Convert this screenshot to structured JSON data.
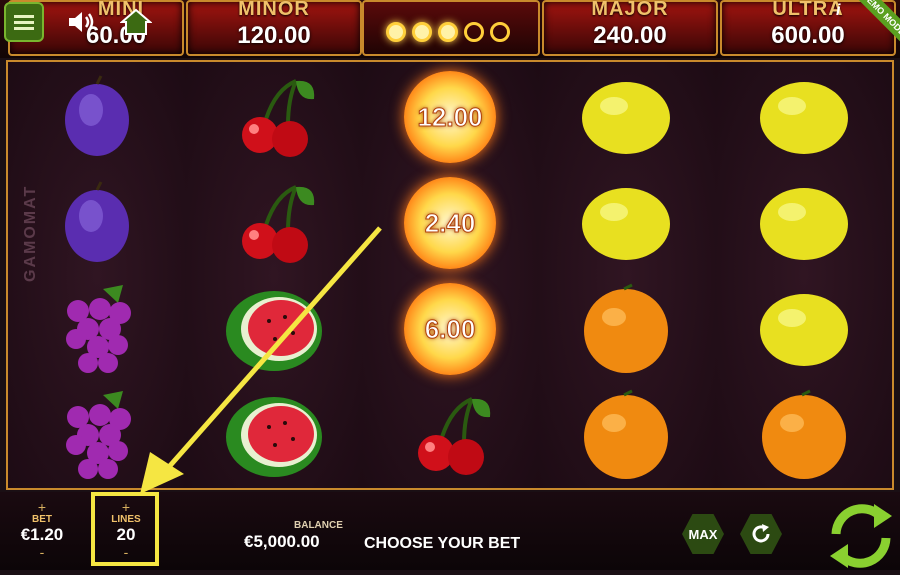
{
  "top": {
    "jackpots": [
      {
        "label": "MINI",
        "value": "60.00"
      },
      {
        "label": "MINOR",
        "value": "120.00"
      },
      {
        "label": "MAJOR",
        "value": "240.00"
      },
      {
        "label": "ULTRA",
        "value": "600.00"
      }
    ],
    "progress_filled": 3,
    "progress_total": 5,
    "demo_badge": "DEMO MODE",
    "info": "i"
  },
  "reels": {
    "brand": "GAMOMAT",
    "columns": [
      [
        "plum",
        "plum",
        "grapes",
        "grapes"
      ],
      [
        "cherries",
        "cherries",
        "watermelon",
        "watermelon"
      ],
      [
        "fireball",
        "fireball",
        "fireball",
        "cherries"
      ],
      [
        "lemon",
        "lemon",
        "orange",
        "orange"
      ],
      [
        "lemon",
        "lemon",
        "lemon",
        "orange"
      ]
    ],
    "fireball_values": [
      "12.00",
      "2.40",
      "6.00"
    ]
  },
  "bottom": {
    "bet_label": "BET",
    "bet_value": "€1.20",
    "lines_label": "LINES",
    "lines_value": "20",
    "balance_label": "BALANCE",
    "balance_value": "€5,000.00",
    "prompt": "CHOOSE YOUR BET",
    "max_label": "MAX",
    "plus": "+",
    "minus": "-"
  },
  "colors": {
    "accent_gold": "#c98a2c",
    "highlight_yellow": "#f5e642",
    "button_green": "#5aa020"
  }
}
